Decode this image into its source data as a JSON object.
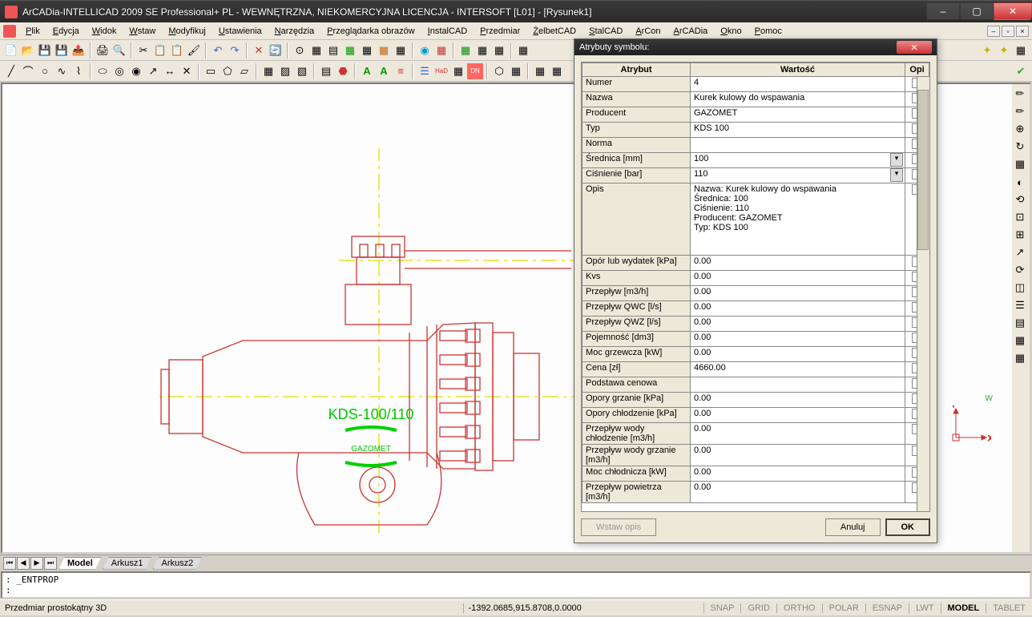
{
  "app_title": "ArCADia-INTELLICAD 2009 SE Professional+ PL - WEWNĘTRZNA, NIEKOMERCYJNA LICENCJA - INTERSOFT [L01] - [Rysunek1]",
  "menus": [
    "Plik",
    "Edycja",
    "Widok",
    "Wstaw",
    "Modyfikuj",
    "Ustawienia",
    "Narzędzia",
    "Przeglądarka obrazów",
    "InstalCAD",
    "Przedmiar",
    "ŻelbetCAD",
    "StalCAD",
    "ArCon",
    "ArCADia",
    "Okno",
    "Pomoc"
  ],
  "drawing_label": "KDS-100/110",
  "drawing_brand": "GAZOMET",
  "dialog": {
    "title": "Atrybuty symbolu:",
    "headers": [
      "Atrybut",
      "Wartość",
      "Opi"
    ],
    "rows": [
      {
        "attr": "Numer",
        "val": "4",
        "combo": false
      },
      {
        "attr": "Nazwa",
        "val": "Kurek kulowy do wspawania",
        "combo": false
      },
      {
        "attr": "Producent",
        "val": "GAZOMET",
        "combo": false
      },
      {
        "attr": "Typ",
        "val": "KDS 100",
        "combo": false
      },
      {
        "attr": "Norma",
        "val": "",
        "combo": false
      },
      {
        "attr": "Średnica [mm]",
        "val": "100",
        "combo": true
      },
      {
        "attr": "Ciśnienie [bar]",
        "val": "110",
        "combo": true
      },
      {
        "attr": "Opis",
        "val": "Nazwa: Kurek kulowy do wspawania\nŚrednica: 100\nCiśnienie: 110\nProducent: GAZOMET\nTyp: KDS 100",
        "combo": false,
        "tall": true
      },
      {
        "attr": "Opór lub wydatek [kPa]",
        "val": "0.00",
        "combo": false
      },
      {
        "attr": "Kvs",
        "val": "0.00",
        "combo": false
      },
      {
        "attr": "Przepływ [m3/h]",
        "val": "0.00",
        "combo": false
      },
      {
        "attr": "Przepływ QWC [l/s]",
        "val": "0.00",
        "combo": false
      },
      {
        "attr": "Przepływ QWZ [l/s]",
        "val": "0.00",
        "combo": false
      },
      {
        "attr": "Pojemność [dm3]",
        "val": "0.00",
        "combo": false
      },
      {
        "attr": "Moc grzewcza [kW]",
        "val": "0.00",
        "combo": false
      },
      {
        "attr": "Cena [zł]",
        "val": "4660.00",
        "combo": false
      },
      {
        "attr": "Podstawa cenowa",
        "val": "",
        "combo": false
      },
      {
        "attr": "Opory grzanie [kPa]",
        "val": "0.00",
        "combo": false
      },
      {
        "attr": "Opory chłodzenie [kPa]",
        "val": "0.00",
        "combo": false
      },
      {
        "attr": "Przepływ wody chłodzenie [m3/h]",
        "val": "0.00",
        "combo": false
      },
      {
        "attr": "Przepływ wody grzanie [m3/h]",
        "val": "0.00",
        "combo": false
      },
      {
        "attr": "Moc chłodnicza [kW]",
        "val": "0.00",
        "combo": false
      },
      {
        "attr": "Przepływ powietrza [m3/h]",
        "val": "0.00",
        "combo": false
      }
    ],
    "btn_insert": "Wstaw opis",
    "btn_cancel": "Anuluj",
    "btn_ok": "OK"
  },
  "sheet_tabs": {
    "model": "Model",
    "a1": "Arkusz1",
    "a2": "Arkusz2"
  },
  "cmd_prompt1": ": _ENTPROP",
  "cmd_prompt2": ":",
  "status": {
    "mode": "Przedmiar prostokątny 3D",
    "coords": "-1392.0685,915.8708,0.0000",
    "toggles": [
      "SNAP",
      "GRID",
      "ORTHO",
      "POLAR",
      "ESNAP",
      "LWT",
      "MODEL",
      "TABLET"
    ],
    "active_toggle": "MODEL"
  }
}
